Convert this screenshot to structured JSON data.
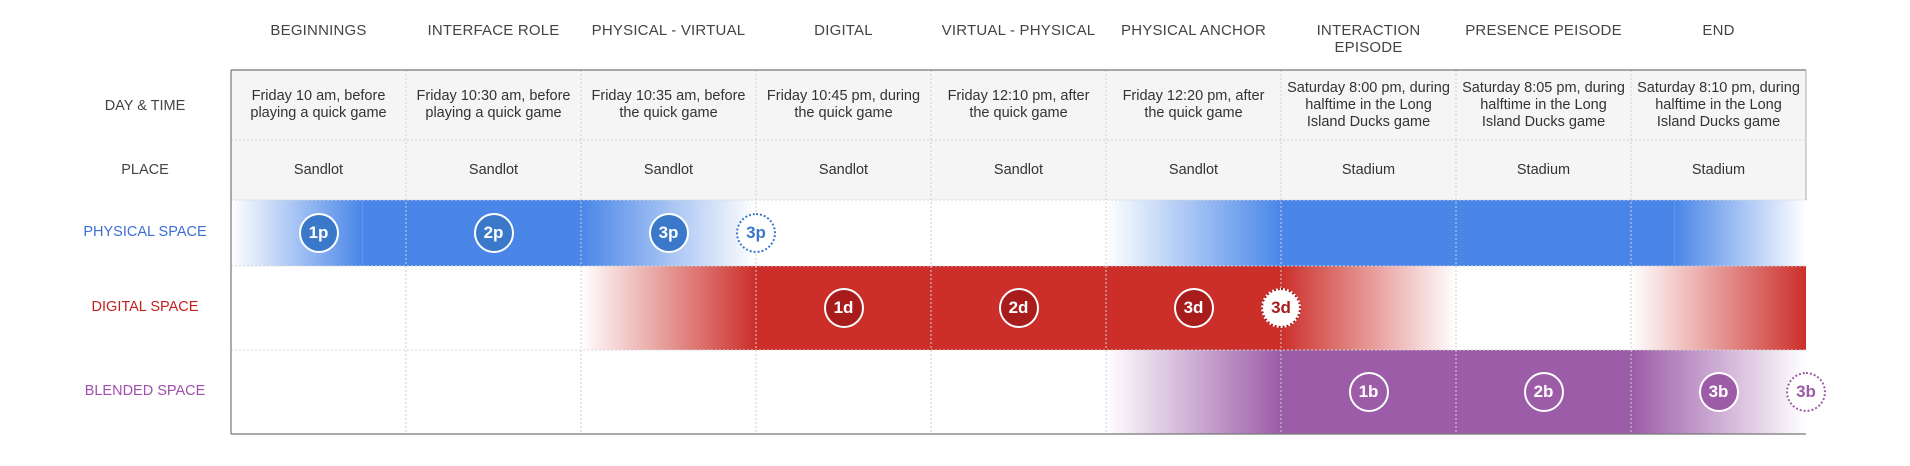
{
  "diagram": {
    "columns": [
      "BEGINNINGS",
      "INTERFACE ROLE",
      "PHYSICAL - VIRTUAL",
      "DIGITAL",
      "VIRTUAL - PHYSICAL",
      "PHYSICAL ANCHOR",
      "INTERACTION EPISODE",
      "PRESENCE PEISODE",
      "END"
    ],
    "rows": {
      "day_time": {
        "label": "DAY & TIME",
        "values": [
          "Friday 10 am, before playing a quick game",
          "Friday 10:30 am, before playing a quick game",
          "Friday 10:35 am, before the quick game",
          "Friday 10:45 pm, during the quick game",
          "Friday 12:10 pm, after the quick game",
          "Friday 12:20 pm, after the quick game",
          "Saturday 8:00 pm, during halftime in the Long Island Ducks game",
          "Saturday 8:05 pm, during halftime in the Long Island Ducks game",
          "Saturday 8:10 pm, during halftime in the Long Island Ducks game"
        ]
      },
      "place": {
        "label": "PLACE",
        "values": [
          "Sandlot",
          "Sandlot",
          "Sandlot",
          "Sandlot",
          "Sandlot",
          "Sandlot",
          "Stadium",
          "Stadium",
          "Stadium"
        ]
      }
    },
    "spaces": [
      {
        "key": "physical",
        "label": "PHYSICAL SPACE",
        "color": "#4a86e8",
        "label_color": "#3d6fd8",
        "marker_fill": "#3a78c9",
        "bands": [
          [
            0,
            0.75,
            "in"
          ],
          [
            0.75,
            2,
            "solid"
          ],
          [
            2,
            3,
            "out"
          ],
          [
            5,
            6,
            "in"
          ],
          [
            6,
            8.25,
            "solid"
          ],
          [
            8.25,
            9,
            "out"
          ]
        ],
        "markers": [
          {
            "text": "1p",
            "col": 0.5,
            "ghost": false
          },
          {
            "text": "2p",
            "col": 1.5,
            "ghost": false
          },
          {
            "text": "3p",
            "col": 2.5,
            "ghost": false
          },
          {
            "text": "3p",
            "col": 3.0,
            "ghost": true
          }
        ]
      },
      {
        "key": "digital",
        "label": "DIGITAL SPACE",
        "color": "#cc2f2a",
        "label_color": "#c0221f",
        "marker_fill": "#a81c1c",
        "bands": [
          [
            2,
            3,
            "in"
          ],
          [
            3,
            6,
            "solid"
          ],
          [
            6,
            7,
            "out"
          ],
          [
            8,
            9,
            "in"
          ]
        ],
        "markers": [
          {
            "text": "1d",
            "col": 3.5,
            "ghost": false
          },
          {
            "text": "2d",
            "col": 4.5,
            "ghost": false
          },
          {
            "text": "3d",
            "col": 5.5,
            "ghost": false
          },
          {
            "text": "3d",
            "col": 6.0,
            "ghost": true
          }
        ]
      },
      {
        "key": "blended",
        "label": "BLENDED SPACE",
        "color": "#9c5ca8",
        "label_color": "#a04fae",
        "marker_fill": "#9c5ca8",
        "bands": [
          [
            5,
            6,
            "in"
          ],
          [
            6,
            8,
            "solid"
          ],
          [
            8,
            9,
            "out"
          ]
        ],
        "markers": [
          {
            "text": "1b",
            "col": 6.5,
            "ghost": false
          },
          {
            "text": "2b",
            "col": 7.5,
            "ghost": false
          },
          {
            "text": "3b",
            "col": 8.5,
            "ghost": false
          },
          {
            "text": "3b",
            "col": 9.0,
            "ghost": true
          }
        ]
      }
    ]
  }
}
